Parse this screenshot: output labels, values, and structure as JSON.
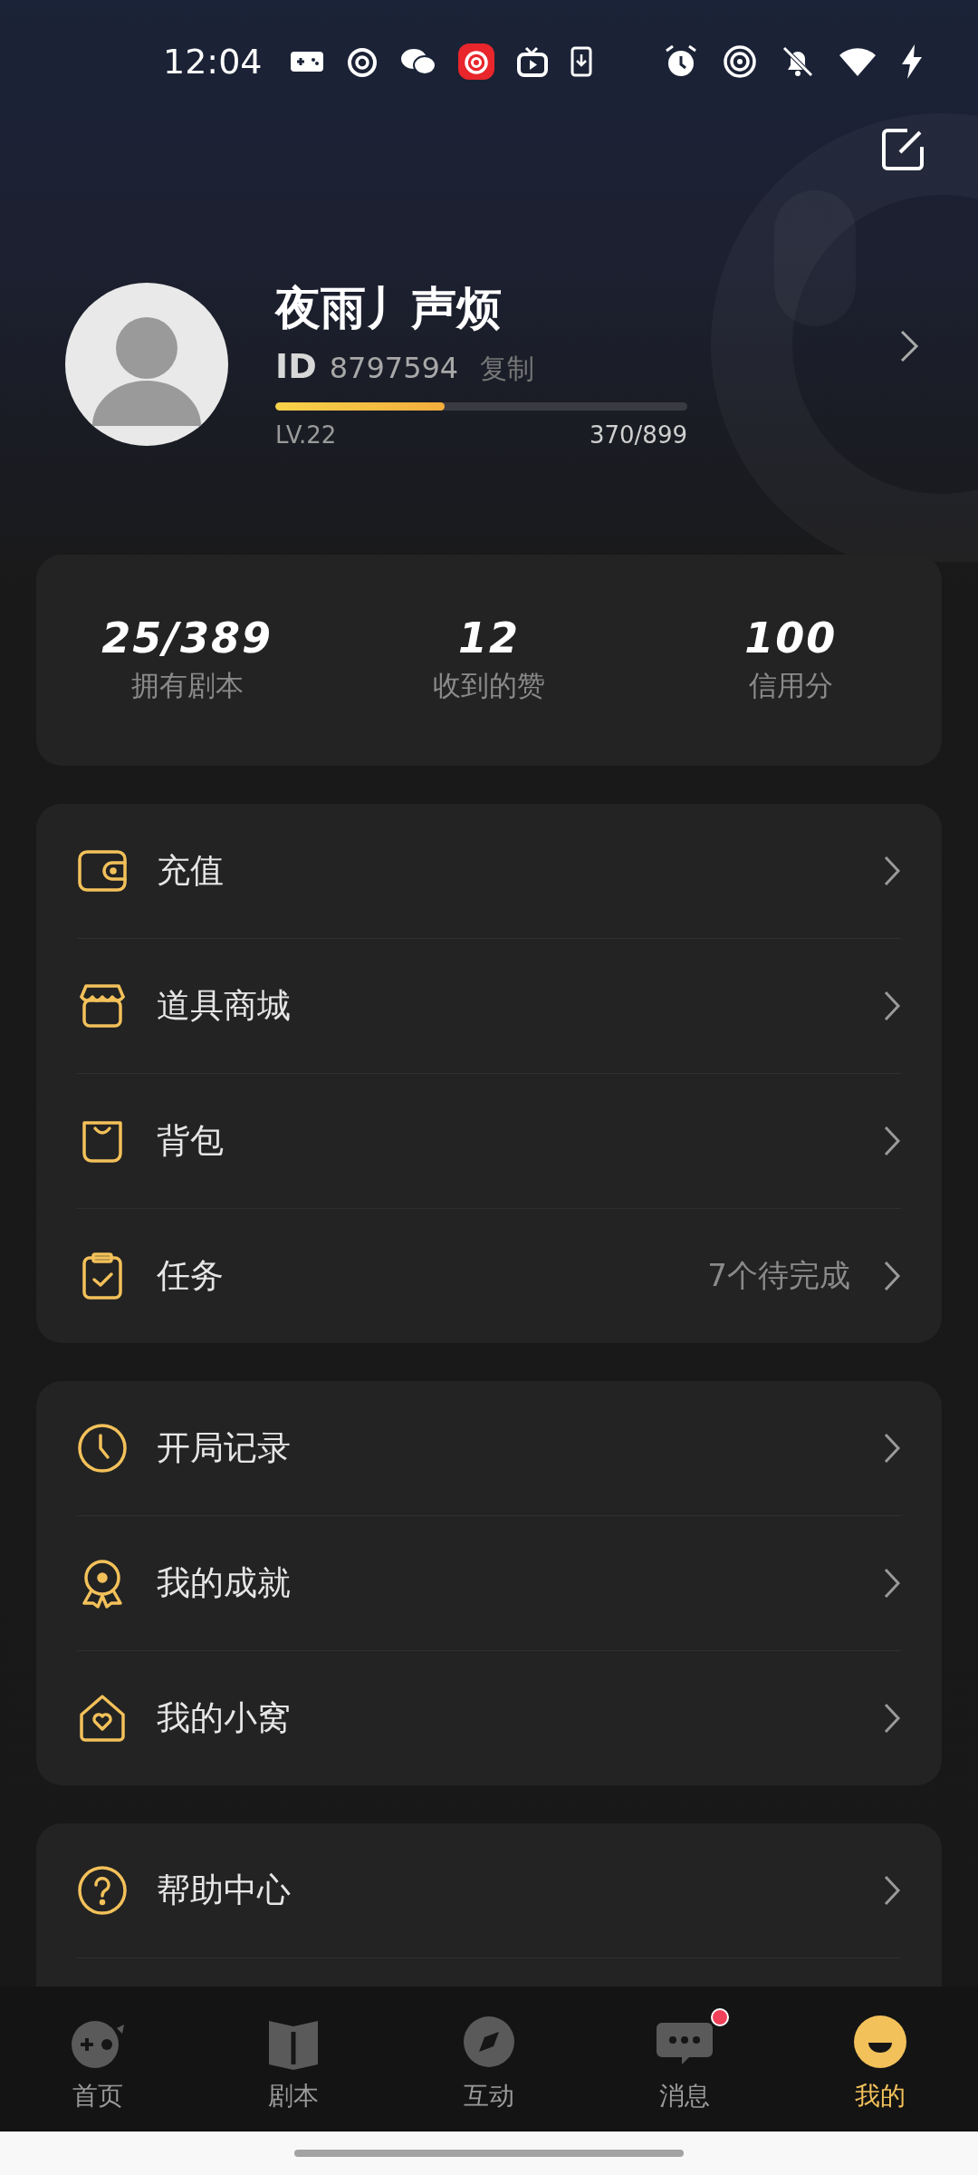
{
  "status_bar": {
    "time": "12:04"
  },
  "profile": {
    "name": "夜雨丿声烦",
    "id_label": "ID",
    "id": "8797594",
    "copy": "复制",
    "level_label": "LV.22",
    "exp": "370/899",
    "level": 0.41
  },
  "stats": [
    {
      "value": "25/389",
      "label": "拥有剧本"
    },
    {
      "value": "12",
      "label": "收到的赞"
    },
    {
      "value": "100",
      "label": "信用分"
    }
  ],
  "menu_groups": [
    [
      {
        "kind": "wallet",
        "label": "充值"
      },
      {
        "kind": "shop",
        "label": "道具商城"
      },
      {
        "kind": "bag",
        "label": "背包"
      },
      {
        "kind": "task",
        "label": "任务",
        "value": "7个待完成"
      }
    ],
    [
      {
        "kind": "clock",
        "label": "开局记录"
      },
      {
        "kind": "medal",
        "label": "我的成就"
      },
      {
        "kind": "home",
        "label": "我的小窝"
      }
    ],
    [
      {
        "kind": "help",
        "label": "帮助中心"
      }
    ]
  ],
  "tab_bar": [
    {
      "kind": "game",
      "label": "首页",
      "selected": false,
      "badge": false
    },
    {
      "kind": "book",
      "label": "剧本",
      "selected": false,
      "badge": false
    },
    {
      "kind": "compass",
      "label": "互动",
      "selected": false,
      "badge": false
    },
    {
      "kind": "chat",
      "label": "消息",
      "selected": false,
      "badge": true
    },
    {
      "kind": "face",
      "label": "我的",
      "selected": true,
      "badge": false
    }
  ]
}
